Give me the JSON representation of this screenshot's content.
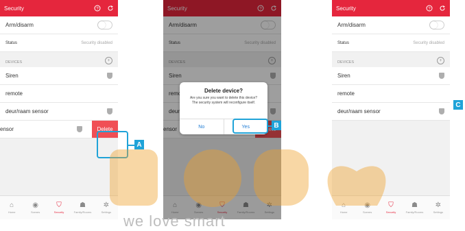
{
  "colors": {
    "accent": "#e5263d",
    "callout": "#1fa3d8",
    "delete": "#f04f55",
    "dialog_button": "#1e7bd4"
  },
  "screens": [
    {
      "header": {
        "title": "Security",
        "help_icon": "question-icon",
        "refresh_icon": "refresh-icon"
      },
      "arm": {
        "label": "Arm/disarm"
      },
      "status": {
        "label": "Status",
        "value": "Security disabled"
      },
      "devices_label": "DEVICES",
      "devices": [
        "Siren",
        "remote",
        "deur/raam sensor",
        "ensor"
      ],
      "delete_label": "Delete",
      "callout": "A"
    },
    {
      "header": {
        "title": "Security"
      },
      "arm": {
        "label": "Arm/disarm"
      },
      "status": {
        "label": "Status",
        "value": "Security disabled"
      },
      "devices_label": "DEVICES",
      "devices": [
        "Siren",
        "remo",
        "deur",
        "ensor"
      ],
      "delete_label": "Delete",
      "dialog": {
        "title": "Delete device?",
        "message": "Are you sure you want to delete this device? The security system will reconfigure itself.",
        "no": "No",
        "yes": "Yes"
      },
      "callout": "B"
    },
    {
      "header": {
        "title": "Security"
      },
      "arm": {
        "label": "Arm/disarm"
      },
      "status": {
        "label": "Status",
        "value": "Security disabled"
      },
      "devices_label": "DEVICES",
      "devices": [
        "Siren",
        "remote",
        "deur/raam sensor"
      ],
      "callout": "C"
    }
  ],
  "tabbar": [
    "Home",
    "Scenes",
    "Security",
    "Family/Rooms",
    "Settings"
  ],
  "watermark": {
    "text": "we love smart"
  }
}
